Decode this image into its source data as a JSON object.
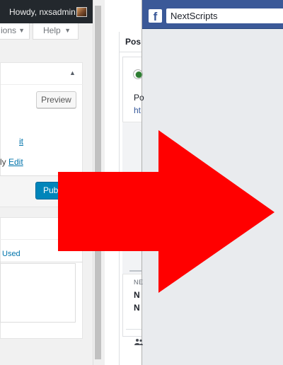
{
  "wordpress": {
    "admin_bar": {
      "greeting": "Howdy, nxsadmin"
    },
    "tabs": [
      {
        "label": "ions",
        "arrow": "▼"
      },
      {
        "label": "Help",
        "arrow": "▼"
      }
    ],
    "publish_box": {
      "toggle": "▲",
      "preview_label": "Preview",
      "edit_link_1": "it",
      "visibility_prefix": "ly ",
      "edit_link_2": "Edit",
      "publish_label": "Publ"
    },
    "categories_box": {
      "tab_label": "Used"
    }
  },
  "facebook": {
    "logo": "f",
    "search_value": "NextScripts",
    "post": {
      "header": "Pos",
      "text_line_1": "Po",
      "text_line_2": "ht",
      "domain": "NE",
      "title_line_1": "N",
      "title_line_2": "N"
    }
  },
  "colors": {
    "wp_admin_bar": "#23282d",
    "wp_primary": "#0085ba",
    "wp_link": "#0073aa",
    "fb_blue": "#3b5998",
    "fb_link": "#365899",
    "arrow_red": "#ff0000"
  },
  "icons": {
    "avatar": "avatar-icon",
    "fb_logo": "facebook-logo-icon",
    "people": "people-icon",
    "arrow": "right-arrow-icon"
  }
}
